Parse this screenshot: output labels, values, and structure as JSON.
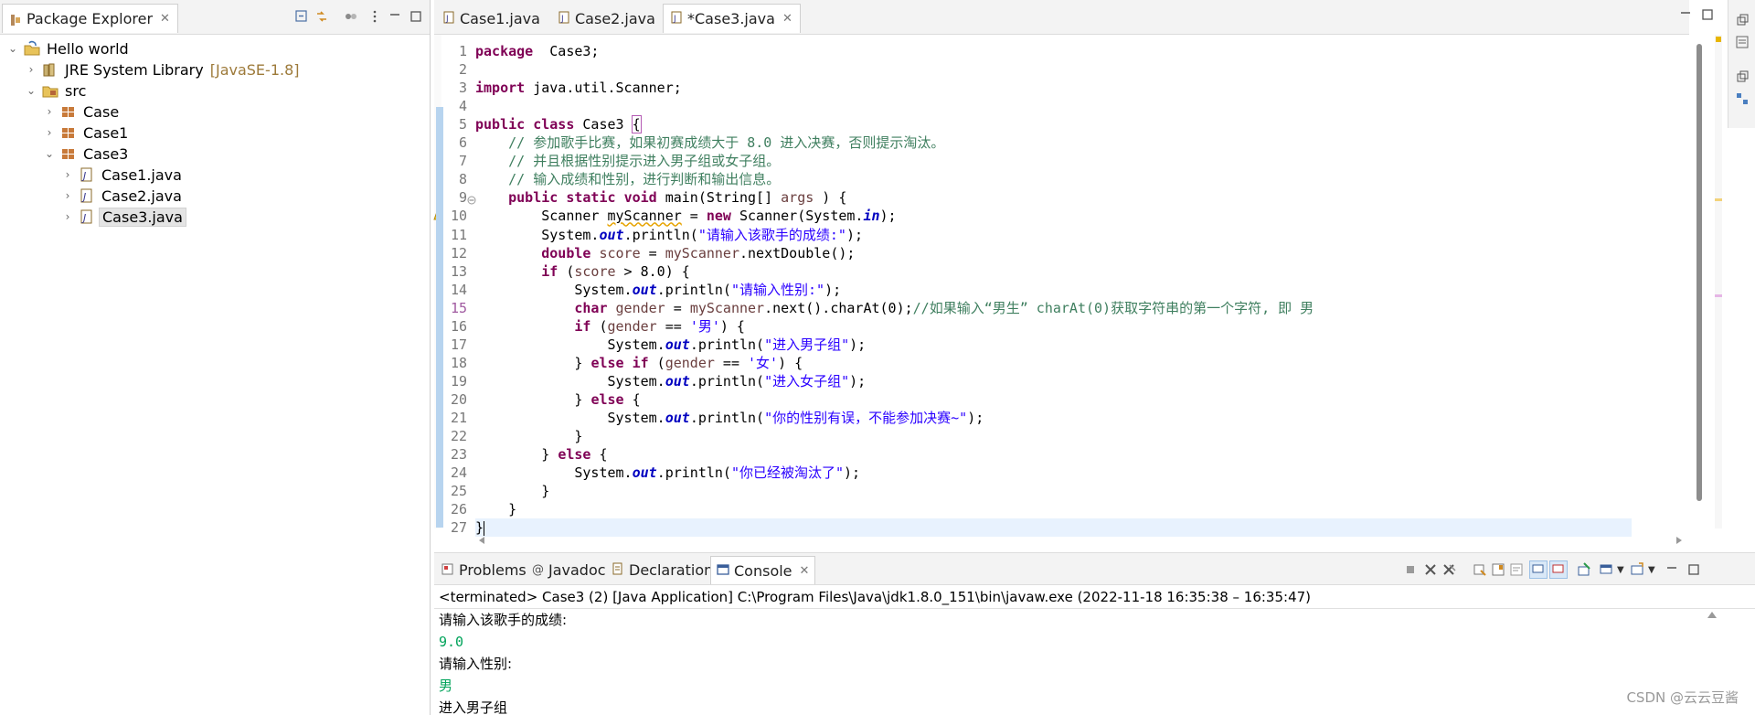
{
  "package_explorer": {
    "tab_title": "Package Explorer",
    "tree": [
      {
        "label": "Hello world",
        "decoration": "",
        "level": 0,
        "expanded": true,
        "icon": "project-icon"
      },
      {
        "label": "JRE System Library",
        "decoration": "[JavaSE-1.8]",
        "level": 1,
        "expanded": false,
        "icon": "library-icon"
      },
      {
        "label": "src",
        "decoration": "",
        "level": 1,
        "expanded": true,
        "icon": "source-folder-icon"
      },
      {
        "label": "Case",
        "decoration": "",
        "level": 2,
        "expanded": false,
        "icon": "package-icon"
      },
      {
        "label": "Case1",
        "decoration": "",
        "level": 2,
        "expanded": false,
        "icon": "package-icon"
      },
      {
        "label": "Case3",
        "decoration": "",
        "level": 2,
        "expanded": true,
        "icon": "package-icon"
      },
      {
        "label": "Case1.java",
        "decoration": "",
        "level": 3,
        "expanded": false,
        "icon": "java-file-icon"
      },
      {
        "label": "Case2.java",
        "decoration": "",
        "level": 3,
        "expanded": false,
        "icon": "java-file-icon"
      },
      {
        "label": "Case3.java",
        "decoration": "",
        "level": 3,
        "expanded": false,
        "icon": "java-file-icon",
        "selected": true
      }
    ]
  },
  "editor": {
    "tabs": [
      {
        "label": "Case1.java",
        "active": false
      },
      {
        "label": "Case2.java",
        "active": false
      },
      {
        "label": "*Case3.java",
        "active": true
      }
    ],
    "lines": [
      [
        [
          "kw",
          "package"
        ],
        [
          "",
          "  Case3;"
        ]
      ],
      [],
      [
        [
          "kw",
          "import"
        ],
        [
          "",
          " java.util.Scanner;"
        ]
      ],
      [],
      [
        [
          "kw",
          "public"
        ],
        [
          "",
          " "
        ],
        [
          "kw",
          "class"
        ],
        [
          "",
          " Case3 "
        ],
        [
          "brk",
          "{"
        ]
      ],
      [
        [
          "",
          "    "
        ],
        [
          "cm",
          "// 参加歌手比赛，如果初赛成绩大于 8.0 进入决赛，否则提示淘汰。"
        ]
      ],
      [
        [
          "",
          "    "
        ],
        [
          "cm",
          "// 并且根据性别提示进入男子组或女子组。"
        ]
      ],
      [
        [
          "",
          "    "
        ],
        [
          "cm",
          "// 输入成绩和性别，进行判断和输出信息。"
        ]
      ],
      [
        [
          "",
          "    "
        ],
        [
          "kw",
          "public"
        ],
        [
          "",
          " "
        ],
        [
          "kw",
          "static"
        ],
        [
          "",
          " "
        ],
        [
          "kw",
          "void"
        ],
        [
          "",
          " main(String[] "
        ],
        [
          "var",
          "args"
        ],
        [
          "",
          " ) {"
        ]
      ],
      [
        [
          "",
          "        Scanner "
        ],
        [
          "warn",
          "myScanner"
        ],
        [
          "",
          " = "
        ],
        [
          "kw",
          "new"
        ],
        [
          "",
          " Scanner(System."
        ],
        [
          "fld",
          "in"
        ],
        [
          "",
          ");"
        ]
      ],
      [
        [
          "",
          "        System."
        ],
        [
          "fld",
          "out"
        ],
        [
          "",
          ".println("
        ],
        [
          "str",
          "\"请输入该歌手的成绩:\""
        ],
        [
          "",
          ");"
        ]
      ],
      [
        [
          "",
          "        "
        ],
        [
          "kw",
          "double"
        ],
        [
          "",
          " "
        ],
        [
          "var",
          "score"
        ],
        [
          "",
          " = "
        ],
        [
          "var",
          "myScanner"
        ],
        [
          "",
          ".nextDouble();"
        ]
      ],
      [
        [
          "",
          "        "
        ],
        [
          "kw",
          "if"
        ],
        [
          "",
          " ("
        ],
        [
          "var",
          "score"
        ],
        [
          "",
          " > 8.0) {"
        ]
      ],
      [
        [
          "",
          "            System."
        ],
        [
          "fld",
          "out"
        ],
        [
          "",
          ".println("
        ],
        [
          "str",
          "\"请输入性别:\""
        ],
        [
          "",
          ");"
        ]
      ],
      [
        [
          "",
          "            "
        ],
        [
          "kw",
          "char"
        ],
        [
          "",
          " "
        ],
        [
          "var",
          "gender"
        ],
        [
          "",
          " = "
        ],
        [
          "var",
          "myScanner"
        ],
        [
          "",
          ".next().charAt(0);"
        ],
        [
          "cm",
          "//如果输入“男生” charAt(0)获取字符串的第一个字符, 即 男"
        ]
      ],
      [
        [
          "",
          "            "
        ],
        [
          "kw",
          "if"
        ],
        [
          "",
          " ("
        ],
        [
          "var",
          "gender"
        ],
        [
          "",
          " == "
        ],
        [
          "str",
          "'男'"
        ],
        [
          "",
          ") {"
        ]
      ],
      [
        [
          "",
          "                System."
        ],
        [
          "fld",
          "out"
        ],
        [
          "",
          ".println("
        ],
        [
          "str",
          "\"进入男子组\""
        ],
        [
          "",
          ");"
        ]
      ],
      [
        [
          "",
          "            } "
        ],
        [
          "kw",
          "else"
        ],
        [
          "",
          " "
        ],
        [
          "kw",
          "if"
        ],
        [
          "",
          " ("
        ],
        [
          "var",
          "gender"
        ],
        [
          "",
          " == "
        ],
        [
          "str",
          "'女'"
        ],
        [
          "",
          ") {"
        ]
      ],
      [
        [
          "",
          "                System."
        ],
        [
          "fld",
          "out"
        ],
        [
          "",
          ".println("
        ],
        [
          "str",
          "\"进入女子组\""
        ],
        [
          "",
          ");"
        ]
      ],
      [
        [
          "",
          "            } "
        ],
        [
          "kw",
          "else"
        ],
        [
          "",
          " {"
        ]
      ],
      [
        [
          "",
          "                System."
        ],
        [
          "fld",
          "out"
        ],
        [
          "",
          ".println("
        ],
        [
          "str",
          "\"你的性别有误，不能参加决赛~\""
        ],
        [
          "",
          ");"
        ]
      ],
      [
        [
          "",
          "            }"
        ]
      ],
      [
        [
          "",
          "        } "
        ],
        [
          "kw",
          "else"
        ],
        [
          "",
          " {"
        ]
      ],
      [
        [
          "",
          "            System."
        ],
        [
          "fld",
          "out"
        ],
        [
          "",
          ".println("
        ],
        [
          "str",
          "\"你已经被淘汰了\""
        ],
        [
          "",
          ");"
        ]
      ],
      [
        [
          "",
          "        }"
        ]
      ],
      [
        [
          "",
          "    }"
        ]
      ],
      [
        [
          "",
          "}"
        ]
      ]
    ]
  },
  "console": {
    "tabs": [
      {
        "label": "Problems",
        "icon": "problems-icon",
        "active": false
      },
      {
        "label": "Javadoc",
        "icon": "at-icon",
        "active": false
      },
      {
        "label": "Declaration",
        "icon": "declaration-icon",
        "active": false
      },
      {
        "label": "Console",
        "icon": "console-icon",
        "active": true
      }
    ],
    "status": "<terminated> Case3 (2) [Java Application] C:\\Program Files\\Java\\jdk1.8.0_151\\bin\\javaw.exe  (2022-11-18 16:35:38 – 16:35:47)",
    "output": [
      {
        "text": "请输入该歌手的成绩:",
        "input": false
      },
      {
        "text": "9.0",
        "input": true
      },
      {
        "text": "请输入性别:",
        "input": false
      },
      {
        "text": "男",
        "input": true
      },
      {
        "text": "进入男子组",
        "input": false
      }
    ]
  },
  "watermark": "CSDN @云云豆酱",
  "colors": {
    "keyword": "#7f0055",
    "comment": "#3f7f5f",
    "string": "#2a00ff",
    "field": "#0000c0",
    "console_input": "#00a35a"
  }
}
